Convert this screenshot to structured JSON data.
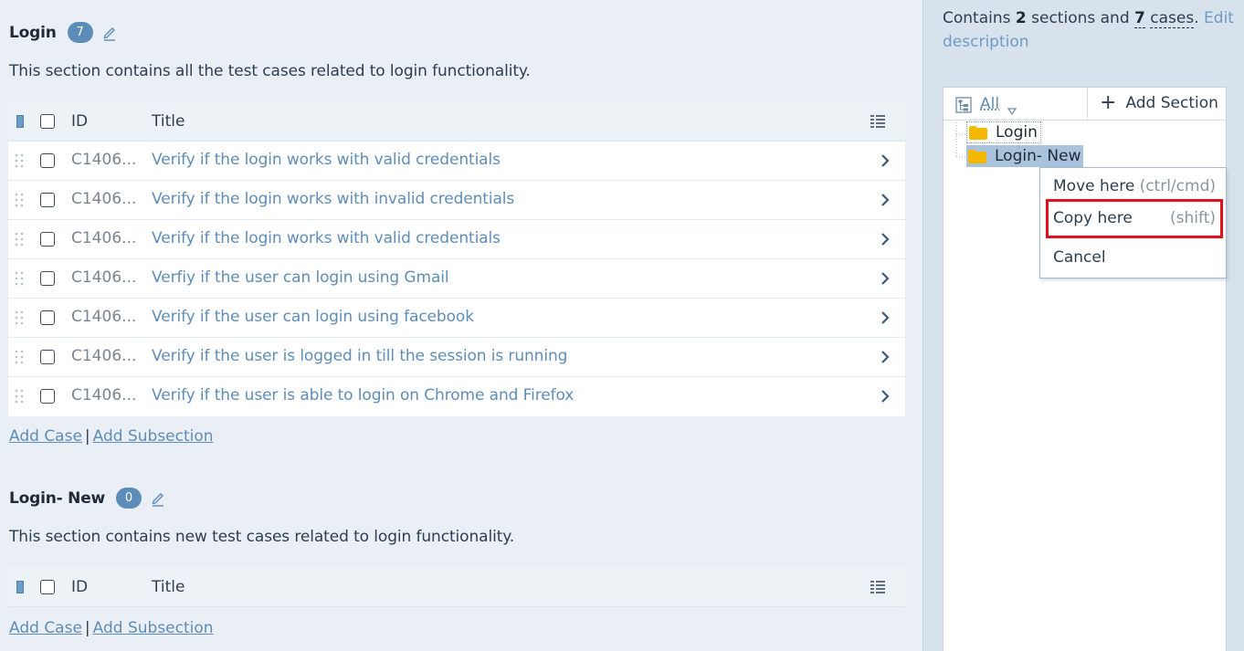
{
  "sections": [
    {
      "title": "Login",
      "count": "7",
      "description": "This section contains all the test cases related to login functionality.",
      "header": {
        "id": "ID",
        "title": "Title"
      },
      "cases": [
        {
          "id": "C1406...",
          "title": "Verify if the login works with valid credentials"
        },
        {
          "id": "C1406...",
          "title": "Verify if the login works with invalid credentials"
        },
        {
          "id": "C1406...",
          "title": "Verify if the login works with valid credentials"
        },
        {
          "id": "C1406...",
          "title": "Verfiy if the user can login using Gmail"
        },
        {
          "id": "C1406...",
          "title": "Verify if the user can login using facebook"
        },
        {
          "id": "C1406...",
          "title": "Verify if the user is logged in till the session is running"
        },
        {
          "id": "C1406...",
          "title": "Verify if the user is able to login on Chrome and Firefox"
        }
      ],
      "links": {
        "add_case": "Add Case",
        "separator": "|",
        "add_subsection": "Add Subsection"
      }
    },
    {
      "title": "Login- New",
      "count": "0",
      "description": "This section contains new test cases related to login functionality.",
      "header": {
        "id": "ID",
        "title": "Title"
      },
      "cases": [],
      "links": {
        "add_case": "Add Case",
        "separator": "|",
        "add_subsection": "Add Subsection"
      }
    }
  ],
  "sidebar": {
    "summary": {
      "prefix": "Contains",
      "sections_count": "2",
      "sections_word": "sections and",
      "cases_count": "7",
      "cases_word": "cases",
      "period": ".",
      "edit_link": "Edit description"
    },
    "tree": {
      "filter_label": "All",
      "add_section": "Add Section",
      "nodes": [
        "Login",
        "Login- New"
      ]
    },
    "context_menu": {
      "items": [
        {
          "label": "Move here",
          "hint": "(ctrl/cmd)"
        },
        {
          "label": "Copy here",
          "hint": "(shift)"
        },
        {
          "label": "Cancel",
          "hint": ""
        }
      ]
    }
  },
  "colors": {
    "accent": "#5f8db7",
    "badge": "#5b8db8",
    "highlight": "#e0101e",
    "folder": "#f5b800"
  }
}
